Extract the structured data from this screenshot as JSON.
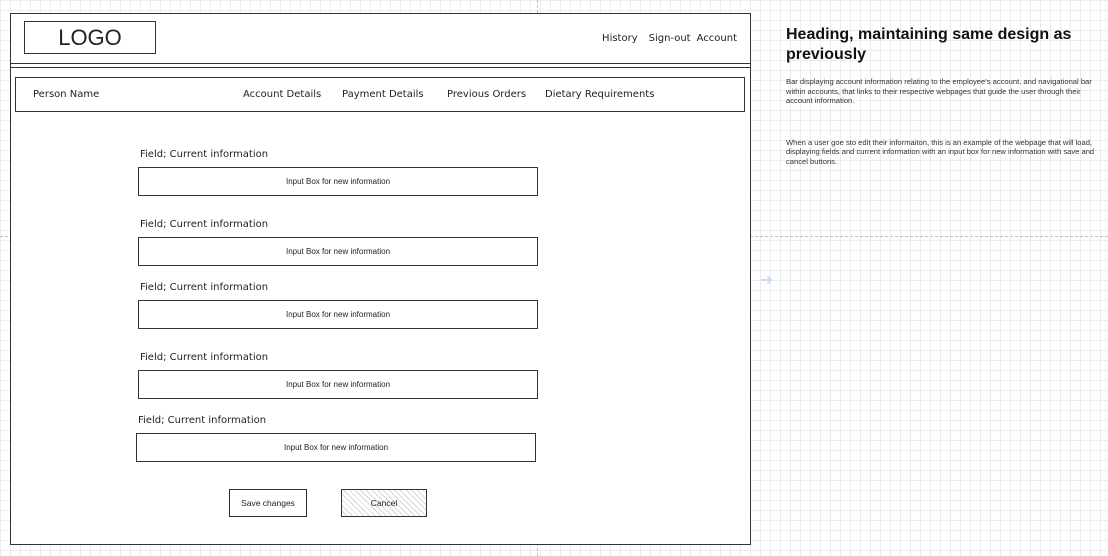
{
  "header": {
    "logo": "LOGO",
    "nav": {
      "history": "History",
      "signout": "Sign-out",
      "account": "Account"
    }
  },
  "infobar": {
    "person_name": "Person Name",
    "links": [
      "Account Details",
      "Payment Details",
      "Previous Orders",
      "Dietary Requirements"
    ]
  },
  "form": {
    "fields": [
      {
        "label": "Field; Current information",
        "input": "Input Box for new information"
      },
      {
        "label": "Field; Current information",
        "input": "Input Box for new information"
      },
      {
        "label": "Field; Current information",
        "input": "Input Box for new information"
      },
      {
        "label": "Field; Current information",
        "input": "Input Box for new information"
      },
      {
        "label": "Field; Current information",
        "input": "Input Box for new information"
      }
    ],
    "save_label": "Save changes",
    "cancel_label": "Cancel"
  },
  "notes": {
    "heading": "Heading, maintaining same design as previously",
    "paragraph1": "Bar displaying account information relating to the employee's account. and navigational bar within accounts, that links to their respective webpages that guide the user through their account information.",
    "paragraph2": "When a user goe sto edit their informaiton, this is an example of the webpage that will load, displaying fields and current information with an input box for new information with save and cancel buttons."
  }
}
